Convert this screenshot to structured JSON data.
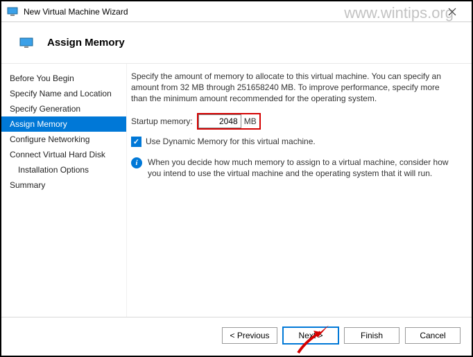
{
  "window": {
    "title": "New Virtual Machine Wizard",
    "watermark": "www.wintips.org",
    "page_heading": "Assign Memory"
  },
  "steps": {
    "before_you_begin": "Before You Begin",
    "specify_name": "Specify Name and Location",
    "specify_generation": "Specify Generation",
    "assign_memory": "Assign Memory",
    "configure_networking": "Configure Networking",
    "connect_vhd": "Connect Virtual Hard Disk",
    "installation_options": "Installation Options",
    "summary": "Summary"
  },
  "main": {
    "description": "Specify the amount of memory to allocate to this virtual machine. You can specify an amount from 32 MB through 251658240 MB. To improve performance, specify more than the minimum amount recommended for the operating system.",
    "startup_label": "Startup memory:",
    "startup_value": "2048",
    "startup_unit": "MB",
    "dynamic_label": "Use Dynamic Memory for this virtual machine.",
    "info_text": "When you decide how much memory to assign to a virtual machine, consider how you intend to use the virtual machine and the operating system that it will run."
  },
  "buttons": {
    "previous": "< Previous",
    "next": "Next >",
    "finish": "Finish",
    "cancel": "Cancel"
  }
}
